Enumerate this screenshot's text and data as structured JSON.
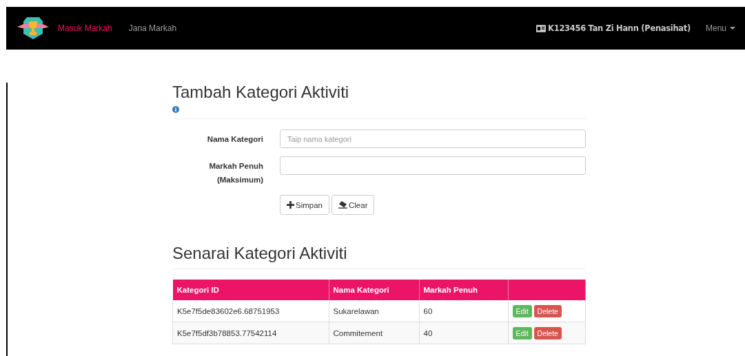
{
  "navbar": {
    "links": [
      {
        "label": "Masuk Markah",
        "selected": true
      },
      {
        "label": "Jana Markah",
        "selected": false
      }
    ],
    "user": "K123456 Tan Zi Hann (Penasihat)",
    "menu": "Menu"
  },
  "form": {
    "title": "Tambah Kategori Aktiviti",
    "fields": [
      {
        "label": "Nama Kategori",
        "placeholder": "Taip nama kategori"
      },
      {
        "label": "Markah Penuh (Maksimum)"
      }
    ],
    "buttons": [
      {
        "label": "Simpan",
        "kind": "save"
      },
      {
        "label": "Clear",
        "kind": "clear"
      }
    ]
  },
  "list": {
    "title": "Senarai Kategori Aktiviti",
    "columns": [
      "Kategori ID",
      "Nama Kategori",
      "Markah Penuh"
    ],
    "rows": [
      {
        "cells": [
          "K5e7f5de83602e6.68751953",
          "Sukarelawan",
          "60"
        ],
        "actions": [
          "Edit",
          "Delete"
        ]
      },
      {
        "cells": [
          "K5e7f5df3b78853.77542114",
          "Commitement",
          "40"
        ],
        "actions": [
          "Edit",
          "Delete"
        ]
      }
    ]
  }
}
